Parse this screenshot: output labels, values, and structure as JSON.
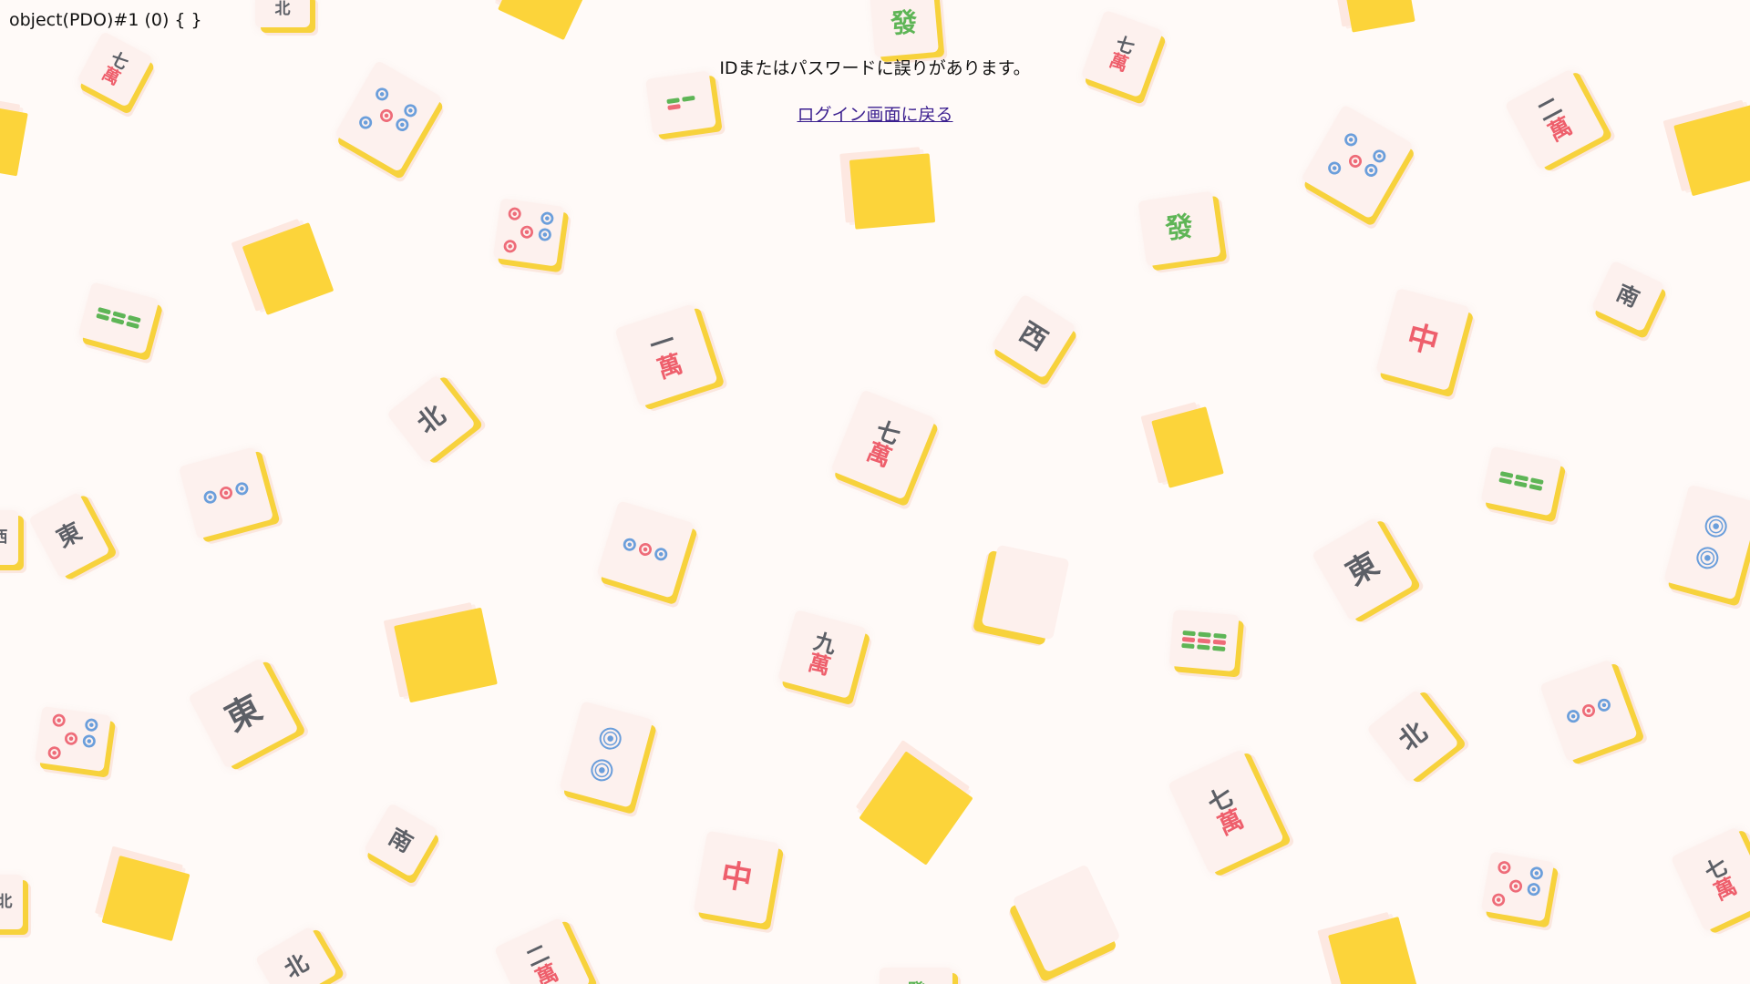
{
  "debug_output": "object(PDO)#1 (0) { }",
  "message": "IDまたはパスワードに誤りがあります。",
  "back_link": {
    "label": "ログイン画面に戻る"
  },
  "background": {
    "page_color": "#fffaf8",
    "tile_face_color": "#fdf1ee",
    "tile_back_color": "#fcd43a",
    "accent_red": "#ee5f6c",
    "accent_blue": "#6a9edb",
    "accent_green": "#5eb556",
    "accent_gray": "#5c5f66",
    "tile_glyphs": {
      "east": "東",
      "south": "南",
      "west": "西",
      "north": "北",
      "red_dragon": "中",
      "green_dragon": "發",
      "man": "萬",
      "one": "一",
      "two": "二",
      "seven": "七",
      "nine": "九"
    }
  }
}
